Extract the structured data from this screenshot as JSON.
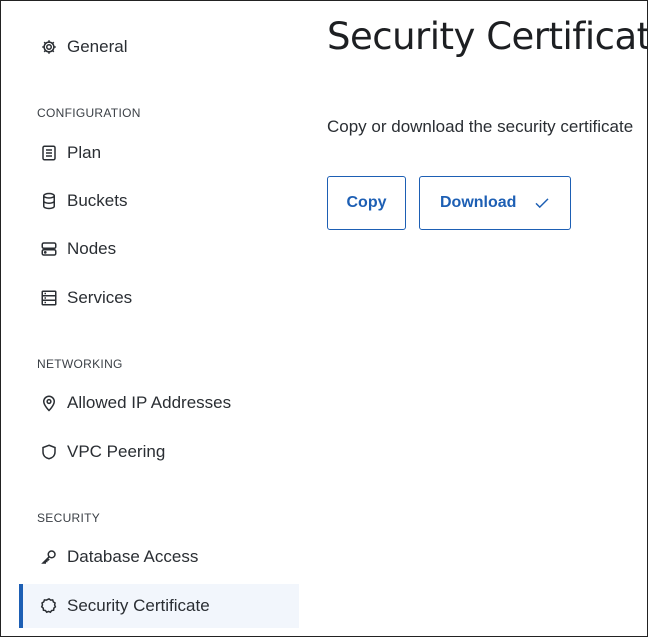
{
  "sidebar": {
    "general": {
      "label": "General",
      "icon": "gear-icon"
    },
    "sections": {
      "configuration": "CONFIGURATION",
      "networking": "NETWORKING",
      "security": "SECURITY"
    },
    "items": {
      "plan": {
        "label": "Plan",
        "icon": "list-icon"
      },
      "buckets": {
        "label": "Buckets",
        "icon": "database-icon"
      },
      "nodes": {
        "label": "Nodes",
        "icon": "server-icon"
      },
      "services": {
        "label": "Services",
        "icon": "rack-icon"
      },
      "allowed_ip": {
        "label": "Allowed IP Addresses",
        "icon": "location-pin-icon"
      },
      "vpc": {
        "label": "VPC Peering",
        "icon": "shield-icon"
      },
      "db_access": {
        "label": "Database Access",
        "icon": "key-icon"
      },
      "sec_cert": {
        "label": "Security Certificate",
        "icon": "certificate-icon",
        "active": true
      }
    }
  },
  "main": {
    "title": "Security Certificate",
    "description": "Copy or download the security certificate",
    "copy_label": "Copy",
    "download_label": "Download",
    "download_icon": "check-icon"
  },
  "colors": {
    "accent": "#1d5fb4",
    "active_bg": "#f2f6fc"
  }
}
